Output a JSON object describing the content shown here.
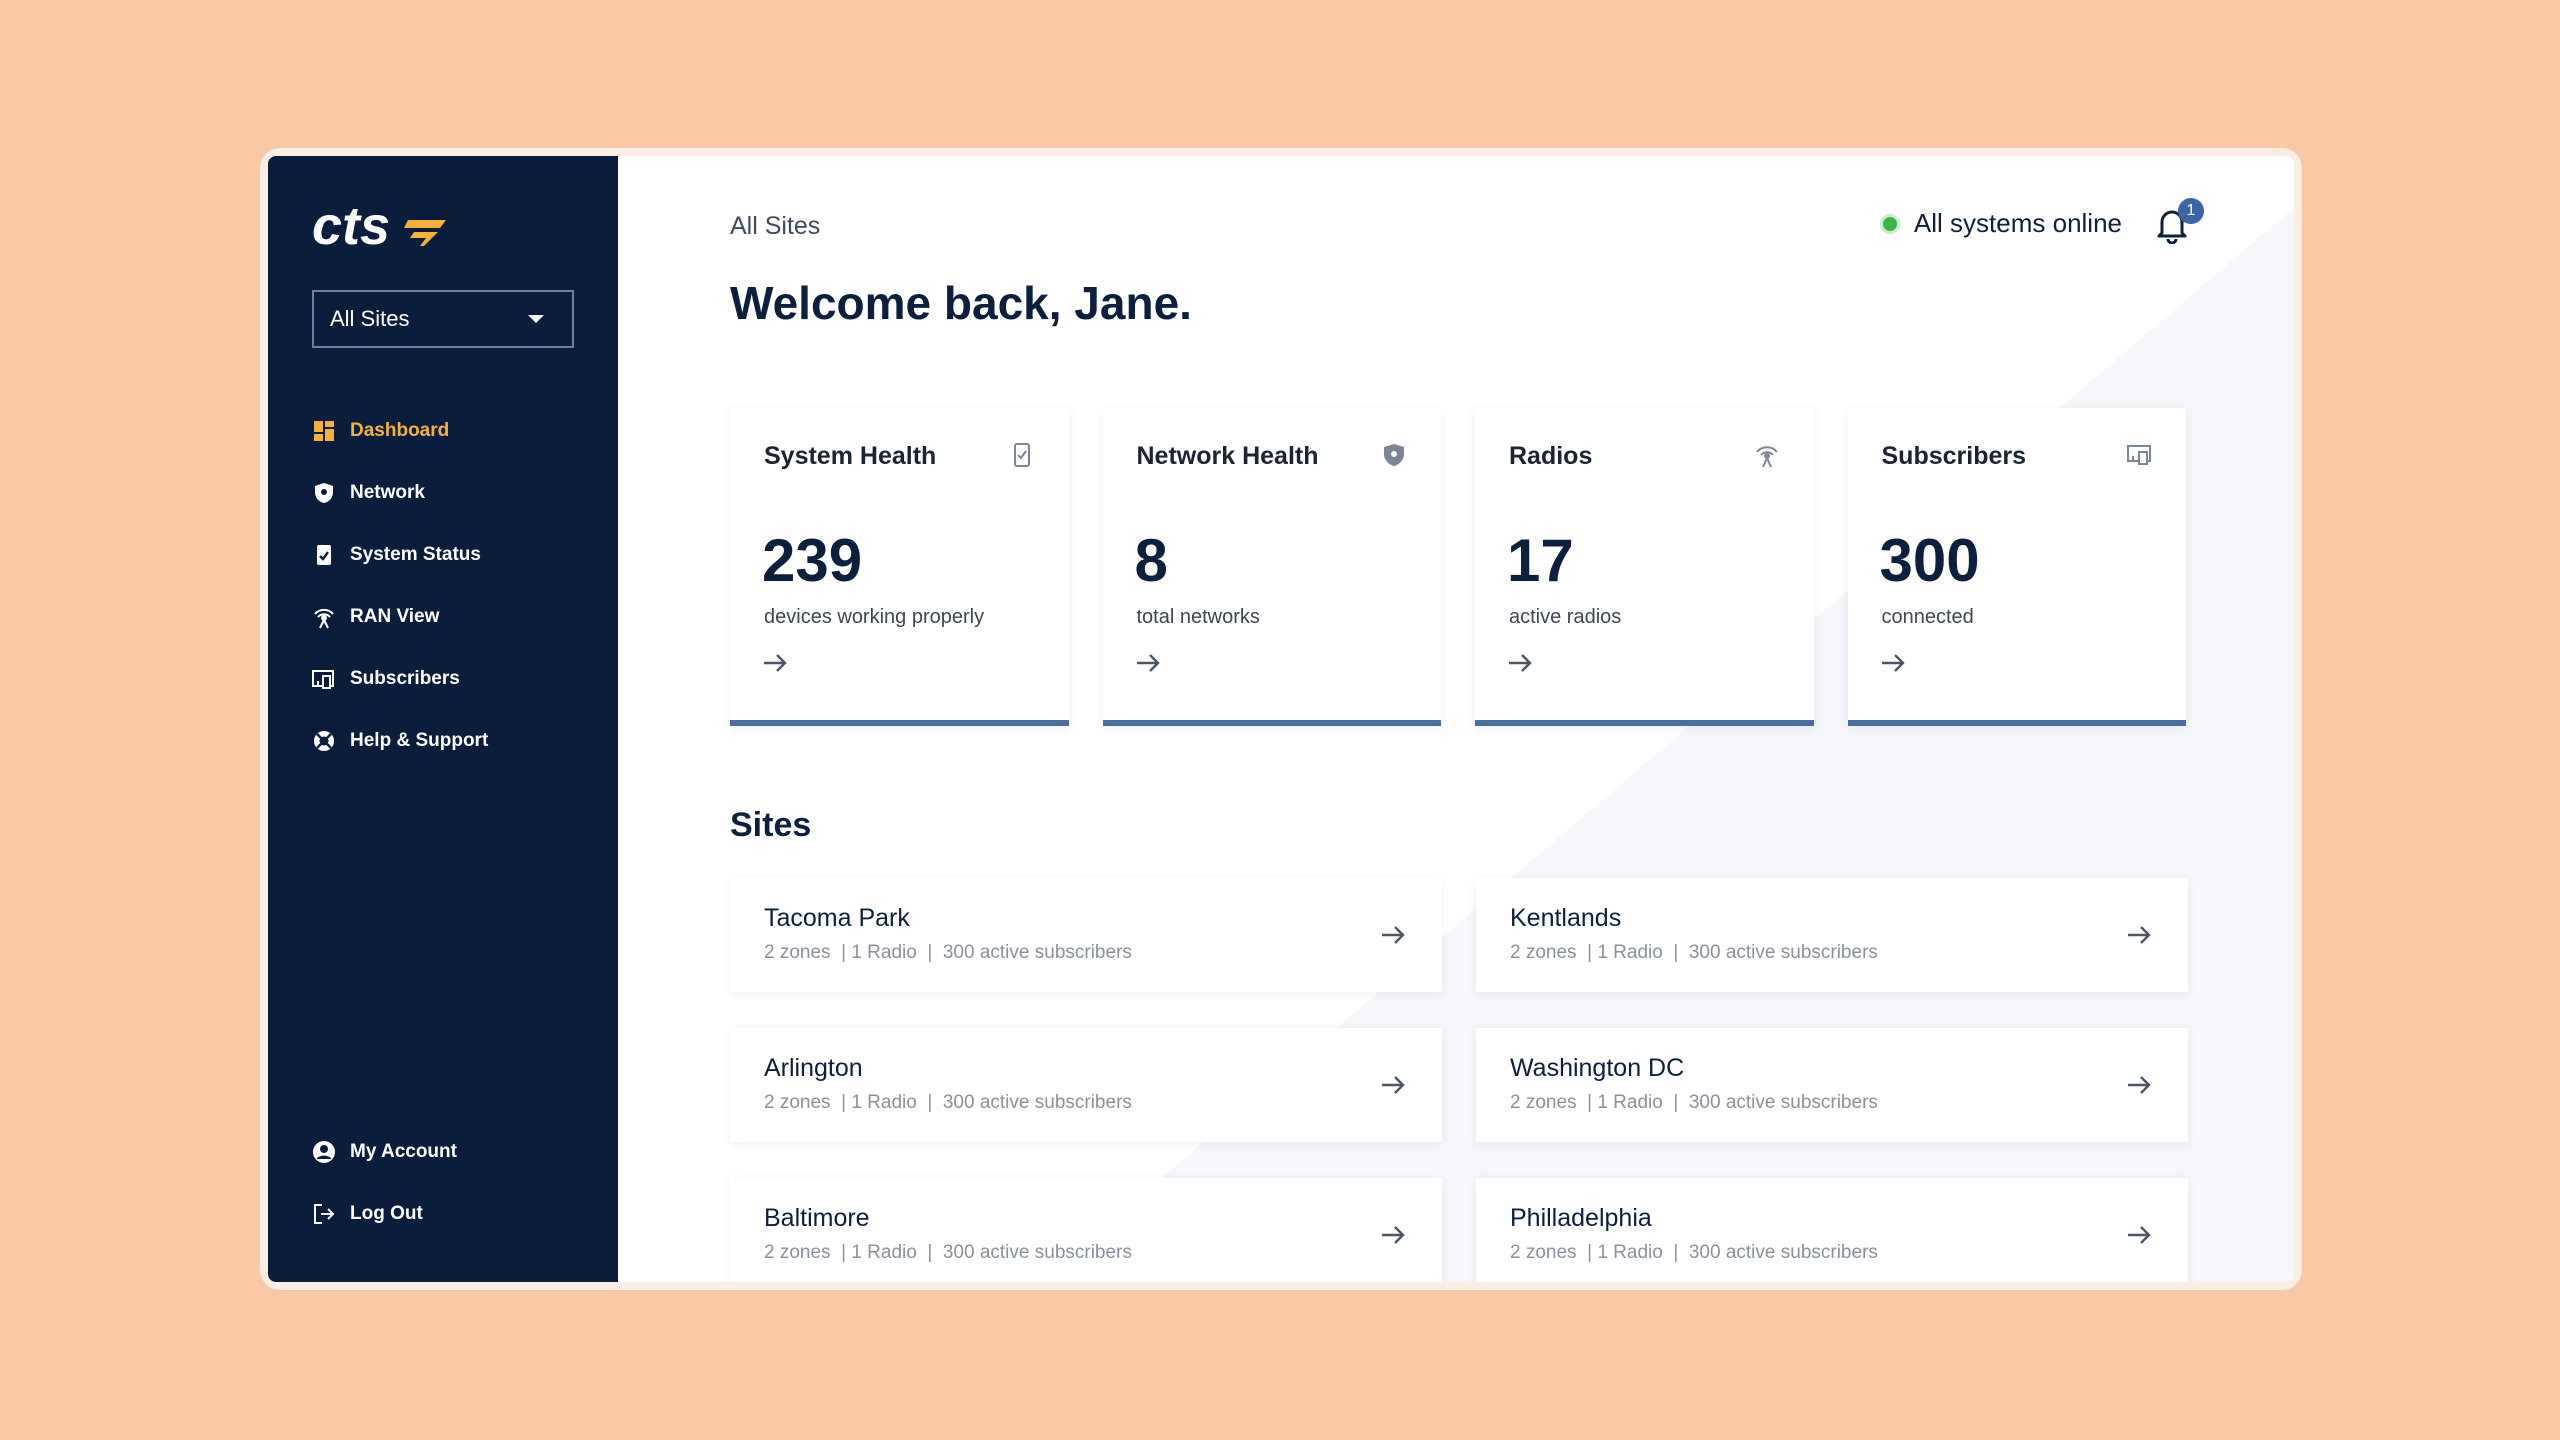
{
  "brand": {
    "logo_text": "cts",
    "accent": "#f5b13c",
    "sidebar_bg": "#0b1d3c"
  },
  "sidebar": {
    "site_select": {
      "value": "All Sites"
    },
    "items": [
      {
        "label": "Dashboard",
        "icon": "dashboard-icon",
        "active": true
      },
      {
        "label": "Network",
        "icon": "shield-icon"
      },
      {
        "label": "System Status",
        "icon": "clipboard-check-icon"
      },
      {
        "label": "RAN View",
        "icon": "antenna-icon"
      },
      {
        "label": "Subscribers",
        "icon": "devices-icon"
      },
      {
        "label": "Help & Support",
        "icon": "lifebuoy-icon"
      }
    ],
    "bottom_items": [
      {
        "label": "My Account",
        "icon": "account-icon"
      },
      {
        "label": "Log Out",
        "icon": "logout-icon"
      }
    ]
  },
  "header": {
    "breadcrumb": "All Sites",
    "status_text": "All systems online",
    "status_color": "#3cb547",
    "notification_count": "1",
    "welcome": "Welcome back, Jane."
  },
  "cards": [
    {
      "title": "System Health",
      "icon": "clipboard-check-icon",
      "value": "239",
      "caption": "devices working properly"
    },
    {
      "title": "Network Health",
      "icon": "shield-icon",
      "value": "8",
      "caption": "total networks"
    },
    {
      "title": "Radios",
      "icon": "antenna-icon",
      "value": "17",
      "caption": "active radios"
    },
    {
      "title": "Subscribers",
      "icon": "devices-icon",
      "value": "300",
      "caption": "connected"
    }
  ],
  "sites_title": "Sites",
  "sites": [
    {
      "name": "Tacoma Park",
      "meta": "2 zones  | 1 Radio  |  300 active subscribers"
    },
    {
      "name": "Kentlands",
      "meta": "2 zones  | 1 Radio  |  300 active subscribers"
    },
    {
      "name": "Arlington",
      "meta": "2 zones  | 1 Radio  |  300 active subscribers"
    },
    {
      "name": "Washington DC",
      "meta": "2 zones  | 1 Radio  |  300 active subscribers"
    },
    {
      "name": "Baltimore",
      "meta": "2 zones  | 1 Radio  |  300 active subscribers"
    },
    {
      "name": "Philladelphia",
      "meta": "2 zones  | 1 Radio  |  300 active subscribers"
    }
  ]
}
